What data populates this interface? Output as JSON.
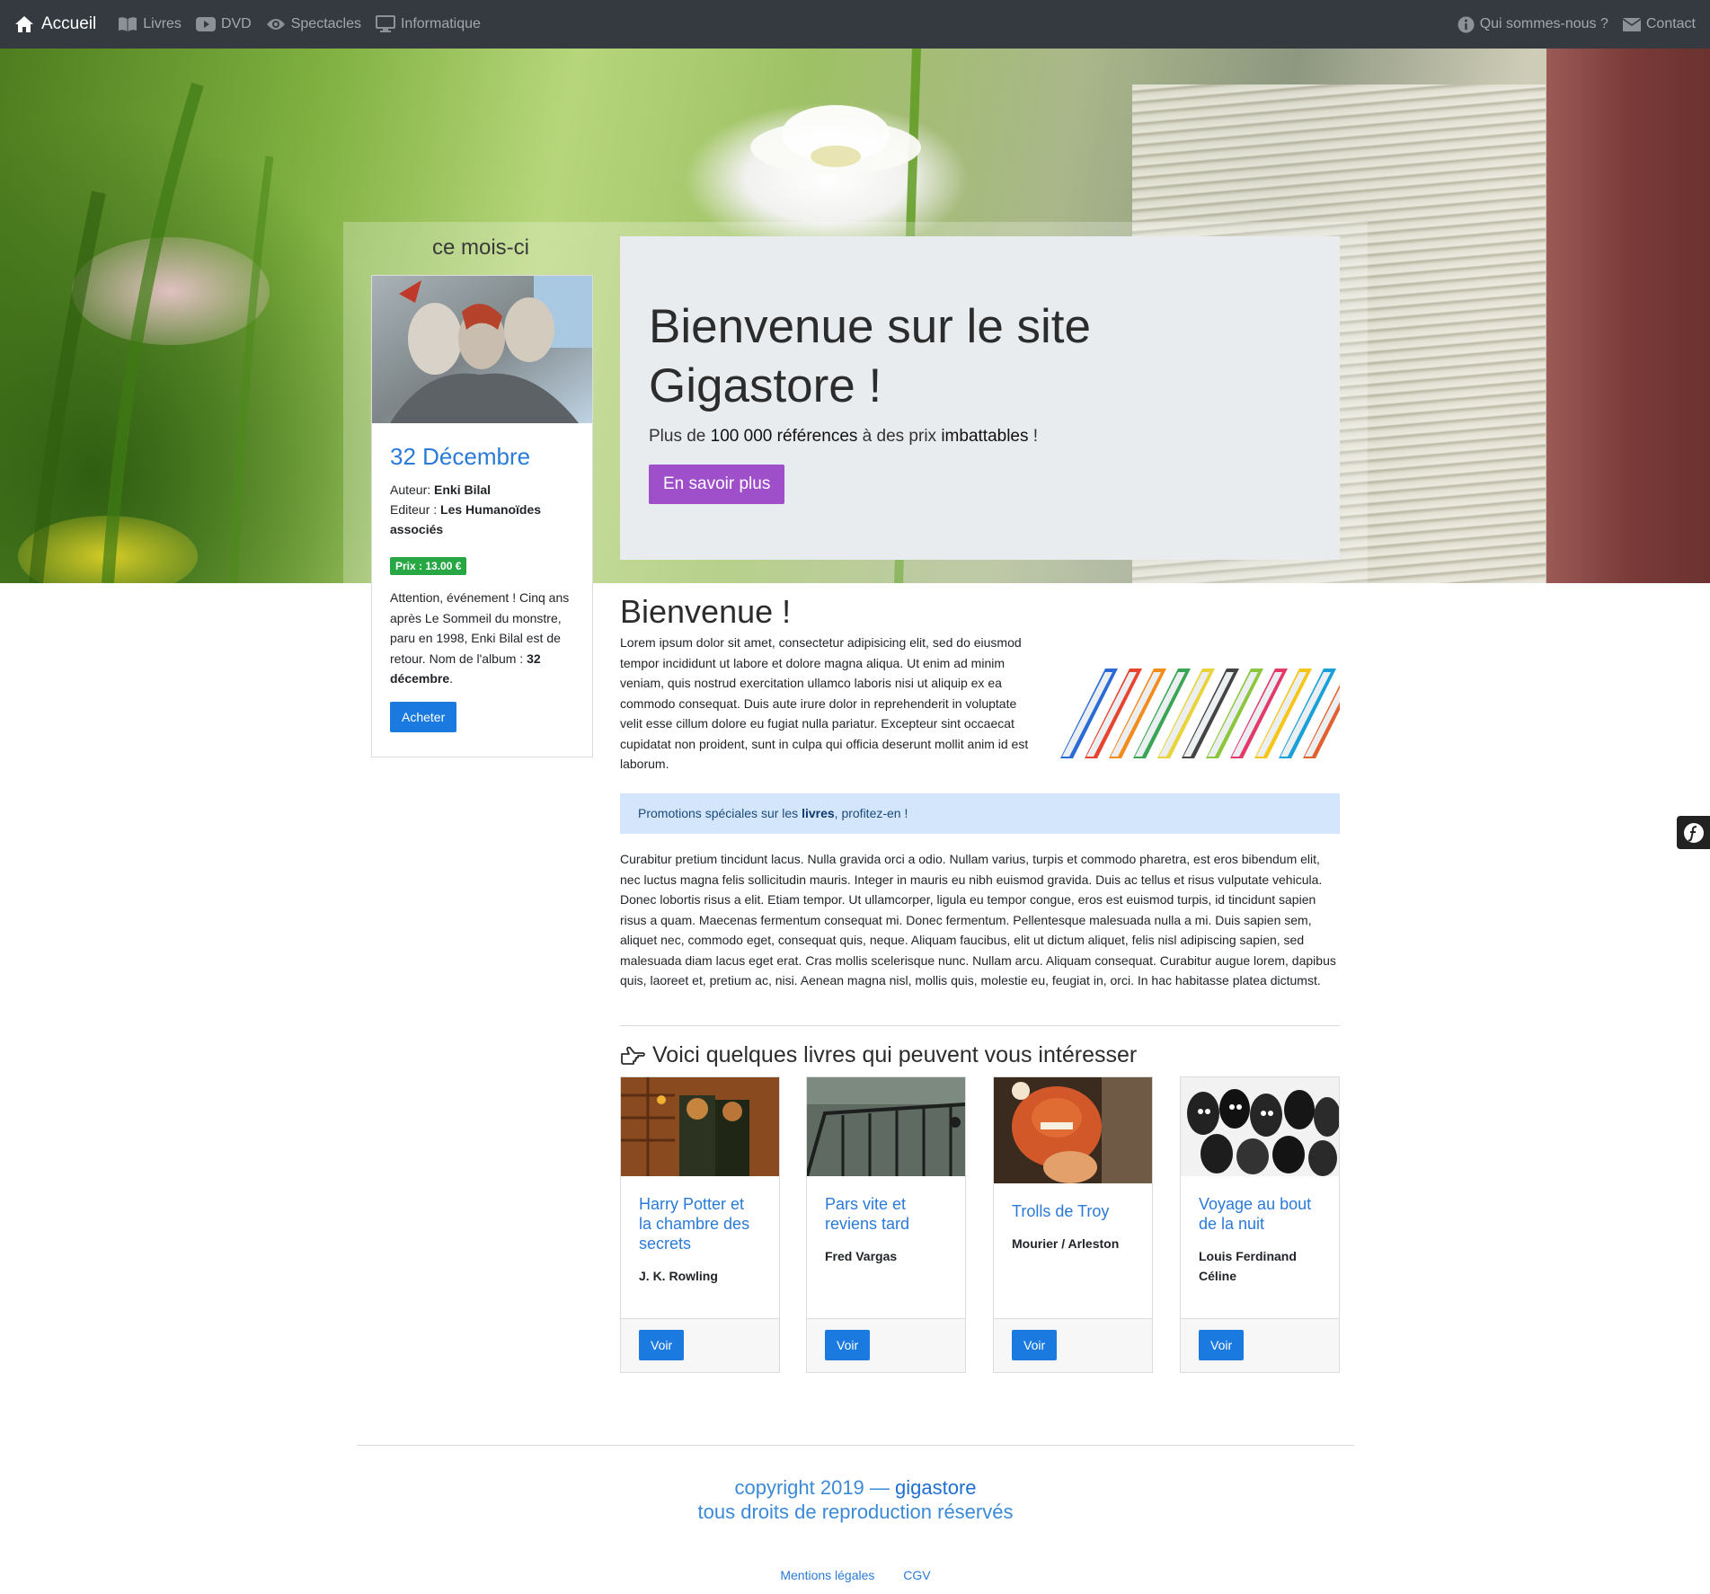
{
  "nav": {
    "brand": "Accueil",
    "items": [
      {
        "label": "Livres",
        "icon": "book-open-icon"
      },
      {
        "label": "DVD",
        "icon": "play-icon"
      },
      {
        "label": "Spectacles",
        "icon": "eye-icon"
      },
      {
        "label": "Informatique",
        "icon": "desktop-icon"
      }
    ],
    "right": [
      {
        "label": "Qui sommes-nous ?",
        "icon": "info-circle-icon"
      },
      {
        "label": "Contact",
        "icon": "envelope-icon"
      }
    ]
  },
  "hero": {
    "month_title": "ce mois-ci",
    "title_line1": "Bienvenue sur le site",
    "title_line2": "Gigastore !",
    "lead_pre": "Plus de ",
    "lead_bold1": "100 000 références",
    "lead_mid": " à des prix ",
    "lead_bold2": "imbattables",
    "lead_post": " !",
    "button": "En savoir plus"
  },
  "featured": {
    "title": "32 Décembre",
    "author_label": "Auteur: ",
    "author": "Enki Bilal",
    "publisher_label": "Editeur : ",
    "publisher": "Les Humanoïdes associés",
    "price": "Prix : 13.00 €",
    "desc_pre": "Attention, événement ! Cinq ans après Le Sommeil du monstre, paru en 1998, Enki Bilal est de retour. Nom de l'album : ",
    "desc_bold": "32 décembre",
    "desc_post": ".",
    "button": "Acheter"
  },
  "main": {
    "heading": "Bienvenue !",
    "intro": "Lorem ipsum dolor sit amet, consectetur adipisicing elit, sed do eiusmod tempor incididunt ut labore et dolore magna aliqua. Ut enim ad minim veniam, quis nostrud exercitation ullamco laboris nisi ut aliquip ex ea commodo consequat. Duis aute irure dolor in reprehenderit in voluptate velit esse cillum dolore eu fugiat nulla pariatur. Excepteur sint occaecat cupidatat non proident, sunt in culpa qui officia deserunt mollit anim id est laborum.",
    "alert_pre": "Promotions spéciales sur les ",
    "alert_bold": "livres",
    "alert_post": ", profitez-en !",
    "para2": "Curabitur pretium tincidunt lacus. Nulla gravida orci a odio. Nullam varius, turpis et commodo pharetra, est eros bibendum elit, nec luctus magna felis sollicitudin mauris. Integer in mauris eu nibh euismod gravida. Duis ac tellus et risus vulputate vehicula. Donec lobortis risus a elit. Etiam tempor. Ut ullamcorper, ligula eu tempor congue, eros est euismod turpis, id tincidunt sapien risus a quam. Maecenas fermentum consequat mi. Donec fermentum. Pellentesque malesuada nulla a mi. Duis sapien sem, aliquet nec, commodo eget, consequat quis, neque. Aliquam faucibus, elit ut dictum aliquet, felis nisl adipiscing sapien, sed malesuada diam lacus eget erat. Cras mollis scelerisque nunc. Nullam arcu. Aliquam consequat. Curabitur augue lorem, dapibus quis, laoreet et, pretium ac, nisi. Aenean magna nisl, mollis quis, molestie eu, feugiat in, orci. In hac habitasse platea dictumst.",
    "section_title": "Voici quelques livres qui peuvent vous intéresser"
  },
  "books": [
    {
      "title": "Harry Potter et la chambre des secrets",
      "author": "J. K. Rowling",
      "button": "Voir"
    },
    {
      "title": "Pars vite et reviens tard",
      "author": "Fred Vargas",
      "button": "Voir"
    },
    {
      "title": "Trolls de Troy",
      "author": "Mourier / Arleston",
      "button": "Voir"
    },
    {
      "title": "Voyage au bout de la nuit",
      "author": "Louis Ferdinand Céline",
      "button": "Voir"
    }
  ],
  "footer": {
    "copy_pre": "copyright 2019 — ",
    "copy_brand": "gigastore",
    "rights": "tous droits de reproduction réservés",
    "links": [
      "Mentions légales",
      "CGV"
    ]
  },
  "colors": {
    "navbar": "#343a40",
    "accent_purple": "#9f4fc9",
    "link_blue": "#2a7ad8",
    "button_blue": "#1a7ae0",
    "price_green": "#28a745",
    "alert_bg": "#d3e6fb"
  }
}
